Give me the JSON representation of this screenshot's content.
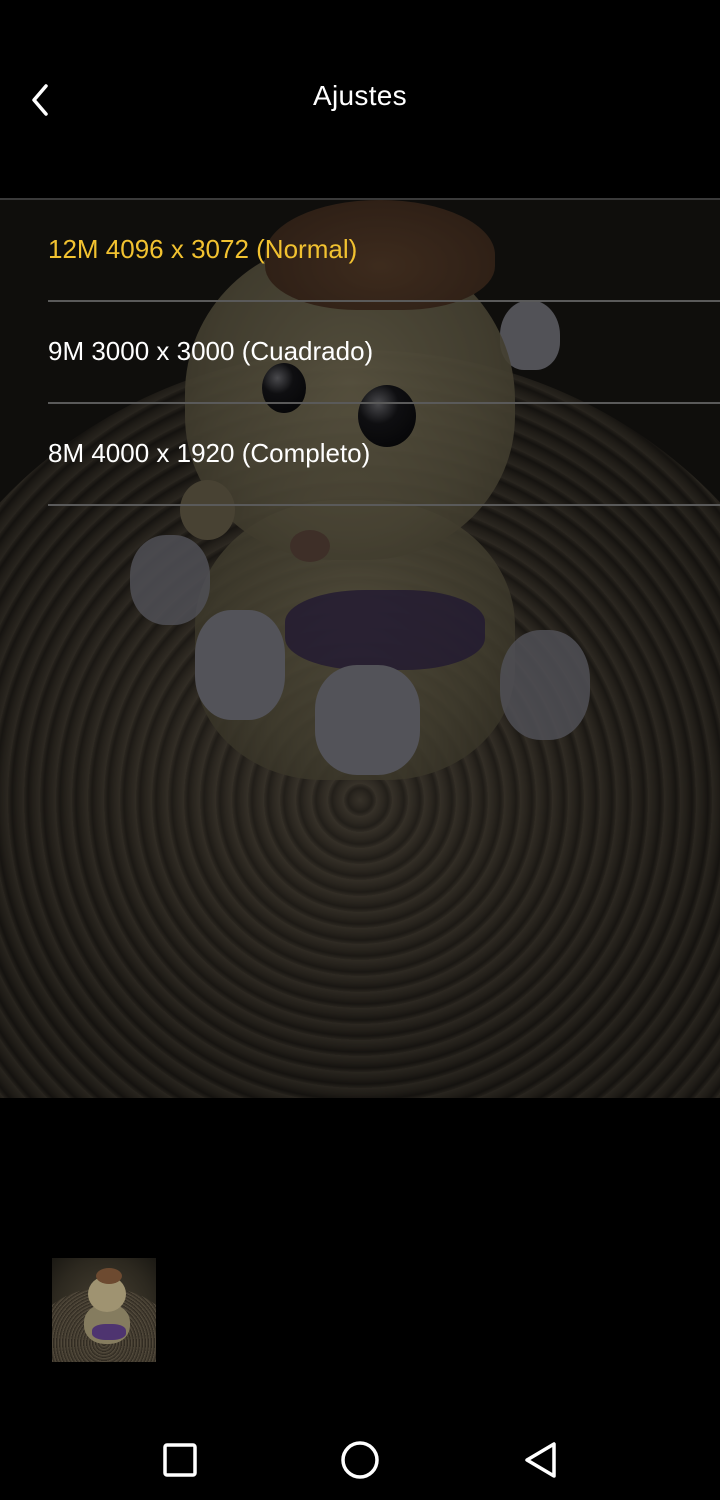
{
  "header": {
    "title": "Ajustes",
    "back_icon": "chevron-left-icon"
  },
  "options": [
    {
      "label": "12M 4096 x 3072 (Normal)",
      "selected": true
    },
    {
      "label": "9M 3000 x 3000 (Cuadrado)",
      "selected": false
    },
    {
      "label": "8M 4000 x 1920 (Completo)",
      "selected": false
    }
  ],
  "colors": {
    "accent": "#f2c230",
    "background": "#000000",
    "text": "#ffffff",
    "divider": "#5a5a5a"
  },
  "navbar": {
    "recents_icon": "square-icon",
    "home_icon": "circle-icon",
    "back_icon": "triangle-back-icon"
  }
}
